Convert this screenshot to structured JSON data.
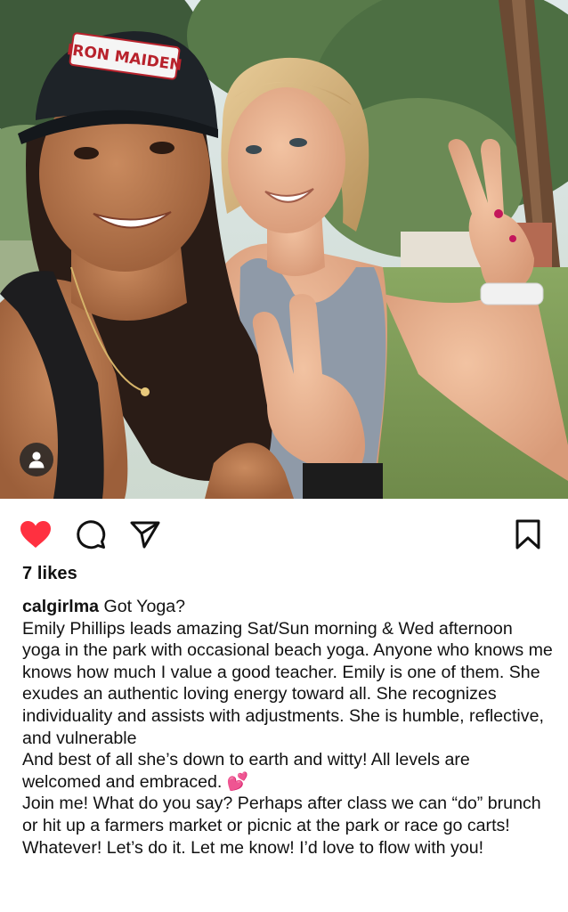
{
  "post": {
    "likes_text": "7 likes",
    "username": "calgirlma",
    "caption_lines": [
      "Got Yoga?",
      "Emily Phillips leads amazing Sat/Sun morning & Wed afternoon yoga in the park with occasional beach yoga. Anyone who knows me knows how much I value a good teacher. Emily is one of them. She exudes an authentic loving energy toward all. She recognizes individuality and assists with adjustments. She is humble, reflective, and vulnerable",
      "And best of all she’s down to earth and witty! All levels are welcomed and embraced.",
      "Join me! What do you say? Perhaps  after class we can “do” brunch or hit up a farmers market or picnic at the park or race go carts! Whatever! Let’s do it. Let me know! I’d love to flow with you!"
    ],
    "emoji": "💕"
  },
  "photo": {
    "cap_text": "IRON MAIDEN"
  },
  "icons": {
    "like": "heart-icon",
    "comment": "comment-icon",
    "share": "paper-plane-icon",
    "save": "bookmark-icon",
    "tag": "person-icon"
  },
  "colors": {
    "liked_heart": "#ff3040",
    "text": "#111111",
    "background": "#ffffff"
  }
}
